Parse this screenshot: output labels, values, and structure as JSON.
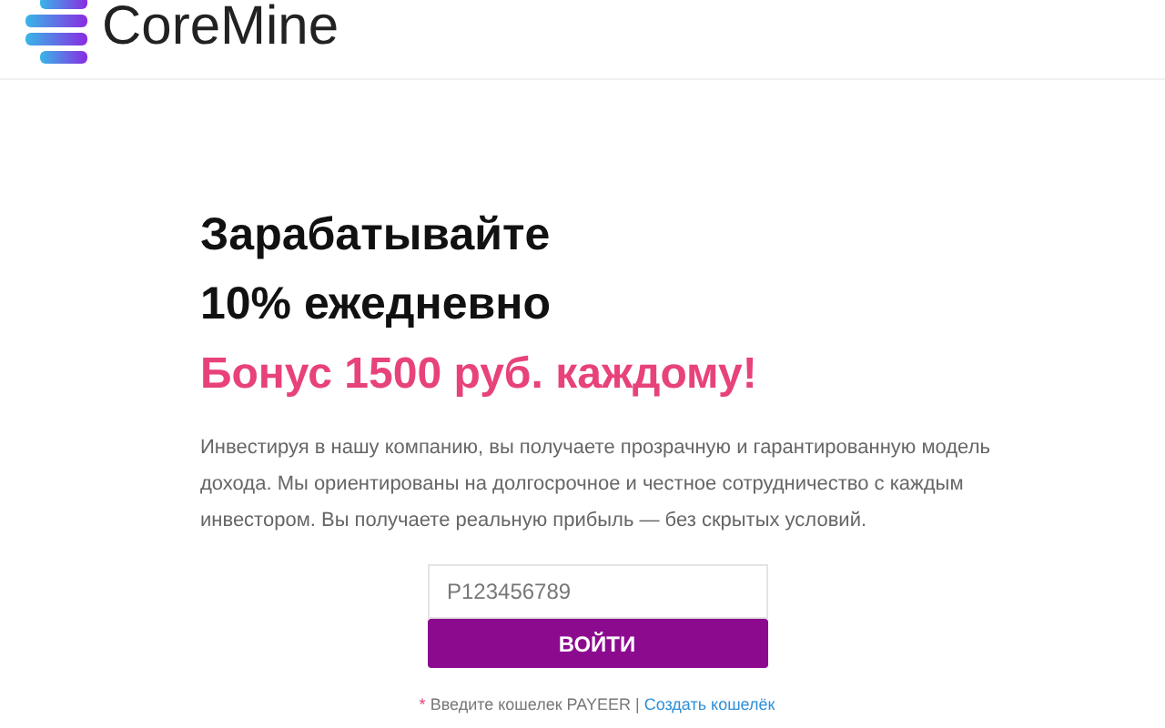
{
  "header": {
    "logo": "CoreMine"
  },
  "hero": {
    "title_lines": [
      "Зарабатывайте",
      "10% ежедневно"
    ],
    "bonus": "Бонус 1500 руб. каждому!",
    "description": "Инвестируя в нашу компанию, вы получаете прозрачную и гарантированную модель дохода. Мы ориентированы на долгосрочное и честное сотрудничество с каждым инвестором. Вы получаете реальную прибыль — без скрытых условий."
  },
  "login": {
    "placeholder": "P123456789",
    "button": "ВОЙТИ",
    "note": {
      "mark": "*",
      "text": "Введите кошелек PAYEER |",
      "link": "Создать кошелёк"
    }
  }
}
